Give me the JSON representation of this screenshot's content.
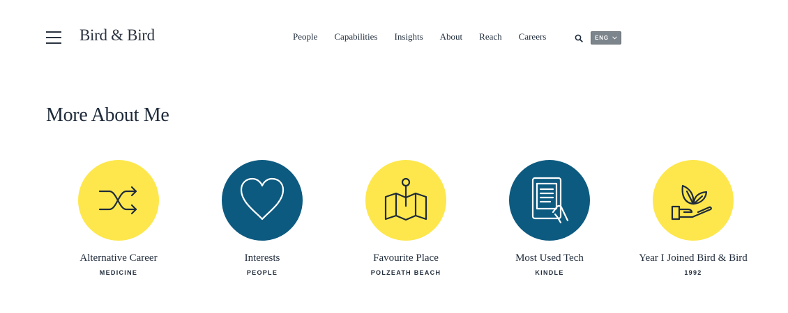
{
  "header": {
    "logo": "Bird & Bird",
    "nav": [
      "People",
      "Capabilities",
      "Insights",
      "About",
      "Reach",
      "Careers"
    ],
    "language": "ENG"
  },
  "section": {
    "title": "More About Me"
  },
  "cards": [
    {
      "icon": "shuffle-icon",
      "color": "#fde74c",
      "label": "Alternative Career",
      "value": "MEDICINE"
    },
    {
      "icon": "heart-icon",
      "color": "#0d5a80",
      "label": "Interests",
      "value": "PEOPLE"
    },
    {
      "icon": "map-pin-icon",
      "color": "#fde74c",
      "label": "Favourite Place",
      "value": "POLZEATH BEACH"
    },
    {
      "icon": "ereader-icon",
      "color": "#0d5a80",
      "label": "Most Used Tech",
      "value": "KINDLE"
    },
    {
      "icon": "plant-hand-icon",
      "color": "#fde74c",
      "label": "Year I Joined Bird & Bird",
      "value": "1992"
    }
  ]
}
